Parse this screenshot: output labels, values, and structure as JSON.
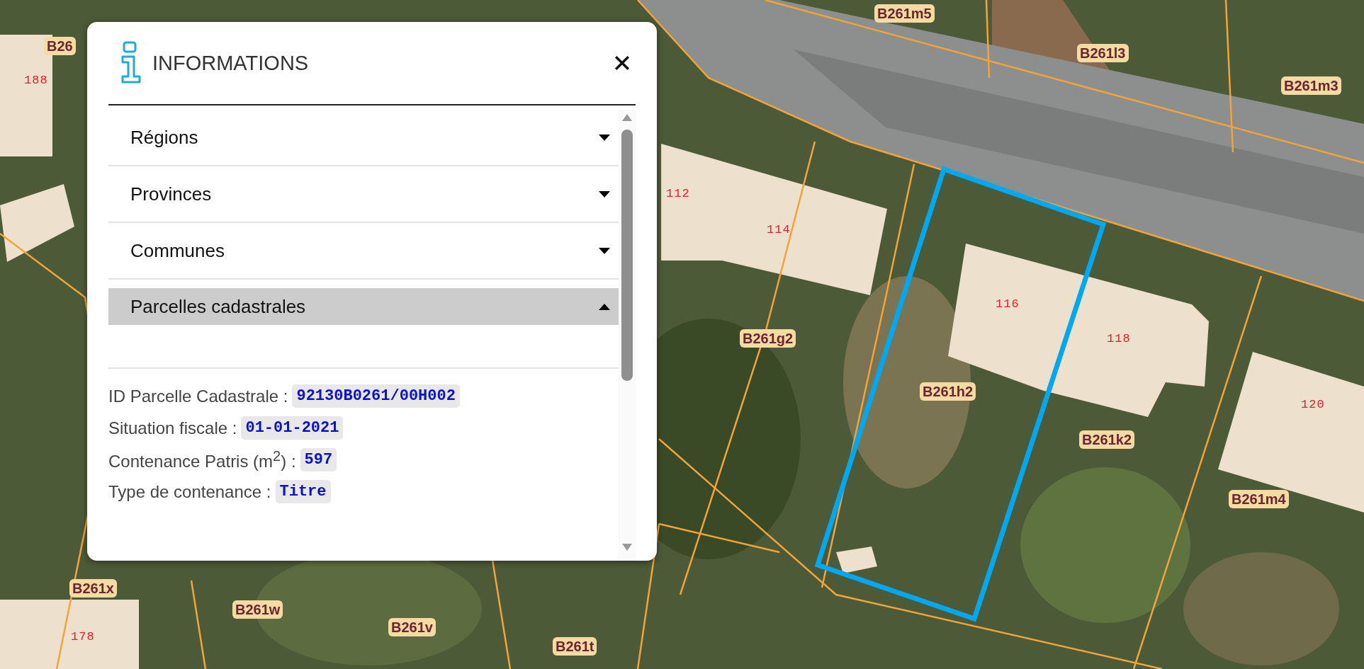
{
  "map": {
    "parcel_labels": [
      "B26",
      "B261m5",
      "B261l3",
      "B261m3",
      "B261g2",
      "B261h2",
      "B261k2",
      "B261m4",
      "B261x",
      "B261w",
      "B261v",
      "B261t"
    ],
    "house_numbers": [
      "188",
      "112",
      "114",
      "116",
      "118",
      "120",
      "178"
    ]
  },
  "panel": {
    "title": "INFORMATIONS",
    "sections": [
      {
        "label": "Régions",
        "expanded": false
      },
      {
        "label": "Provinces",
        "expanded": false
      },
      {
        "label": "Communes",
        "expanded": false
      },
      {
        "label": "Parcelles cadastrales",
        "expanded": true
      }
    ],
    "properties": [
      {
        "label": "ID Parcelle Cadastrale :",
        "value": "92130B0261/00H002"
      },
      {
        "label": "Situation fiscale :",
        "value": "01-01-2021"
      },
      {
        "label": "Contenance Patris (m$^{2}$) :",
        "value": "597"
      },
      {
        "label": "Type de contenance :",
        "value": "Titre"
      }
    ]
  }
}
